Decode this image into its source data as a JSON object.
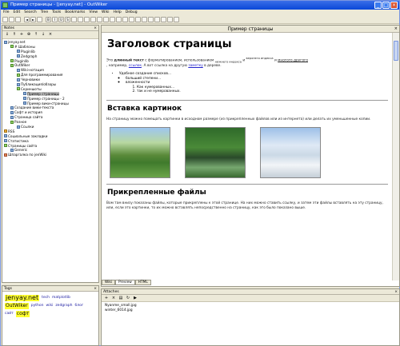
{
  "window": {
    "title": "Пример страницы - [jenyay.net] - OutWiker"
  },
  "menu": [
    "File",
    "Edit",
    "Search",
    "Tree",
    "Tools",
    "Bookmarks",
    "View",
    "Wiki",
    "Help",
    "Debug"
  ],
  "notes": {
    "title": "Notes",
    "close": "×",
    "tree": [
      {
        "d": 0,
        "label": "jenyay.net",
        "icon": "root"
      },
      {
        "d": 1,
        "label": "# Шаблоны",
        "icon": "fold"
      },
      {
        "d": 2,
        "label": "Pluginlib",
        "icon": "note"
      },
      {
        "d": 2,
        "label": "Zedgraph",
        "icon": "note"
      },
      {
        "d": 1,
        "label": "Pluginlib",
        "icon": "fold"
      },
      {
        "d": 1,
        "label": "OutWiker",
        "icon": "fold"
      },
      {
        "d": 2,
        "label": "Wiki-нотация",
        "icon": "note"
      },
      {
        "d": 2,
        "label": "Для программирования",
        "icon": "fold"
      },
      {
        "d": 2,
        "label": "Черновики",
        "icon": "note"
      },
      {
        "d": 2,
        "label": "Публикация/обзоры",
        "icon": "note"
      },
      {
        "d": 2,
        "label": "Скриншоты",
        "icon": "fold"
      },
      {
        "d": 3,
        "label": "Пример страницы",
        "icon": "note",
        "sel": true
      },
      {
        "d": 3,
        "label": "Пример страницы - 2",
        "icon": "note"
      },
      {
        "d": 3,
        "label": "Пример вики-страницы",
        "icon": "note"
      },
      {
        "d": 1,
        "label": "Создание вики-текста",
        "icon": "note"
      },
      {
        "d": 1,
        "label": "Софт и история",
        "icon": "note"
      },
      {
        "d": 1,
        "label": "Страница сайта",
        "icon": "note"
      },
      {
        "d": 1,
        "label": "Разное",
        "icon": "fold"
      },
      {
        "d": 2,
        "label": "Ссылки",
        "icon": "note"
      },
      {
        "d": 0,
        "label": "RSS",
        "icon": "orange"
      },
      {
        "d": 0,
        "label": "Социальные закладки",
        "icon": "note"
      },
      {
        "d": 0,
        "label": "Статистика",
        "icon": "note"
      },
      {
        "d": 0,
        "label": "Страницы сайта",
        "icon": "fold"
      },
      {
        "d": 1,
        "label": "Generic",
        "icon": "note"
      },
      {
        "d": 0,
        "label": "Шпаргалка по jenWiki",
        "icon": "red"
      }
    ]
  },
  "tags": {
    "title": "Tags",
    "close": "×",
    "items": [
      {
        "label": "jenyay.net",
        "size": "big"
      },
      {
        "label": "tech",
        "size": "small"
      },
      {
        "label": "matplotlib",
        "size": "small"
      },
      {
        "label": "OutWiker",
        "size": "med"
      },
      {
        "label": "python",
        "size": "small"
      },
      {
        "label": "wiki",
        "size": "small"
      },
      {
        "label": "zedgraph",
        "size": "small"
      },
      {
        "label": "блог",
        "size": "small"
      },
      {
        "label": "сайт",
        "size": "small"
      },
      {
        "label": "софт",
        "size": "med"
      }
    ]
  },
  "page": {
    "title": "Пример страницы",
    "close": "×",
    "h1": "Заголовок страницы",
    "p1a": "Это ",
    "p1b": "длинный текст",
    "p1c": " с форматированием, использованием ",
    "p1d": "нижнего индекса",
    "p1e": " и ",
    "p1f": "верхнего индекса",
    "p1g": " и ",
    "p1h": "многого другого",
    "p1_tail": ", например, ",
    "link1": "ссылок",
    "p1_mid": ". А вот ссылка на другую ",
    "link2": "заметку",
    "p1_end": " в дереве.",
    "list_top": "Удобное создание списков...",
    "list_2": "больший степени...",
    "list_3": "вложенности",
    "ol1": "Как нумерованных...",
    "ol2": "так и не нумерованных.",
    "h2a": "Вставка картинок",
    "p2": "На страницу можно помещать картинки в исходном размере (из прикрепленных файлов или из интернета) или делать их уменьшенные копии.",
    "h2b": "Прикрепленные файлы",
    "p3": "Вом там внизу показаны файлы, которые прикреплены к этой странице. На них можно ставить ссылку, и затем эти файлы вставлять на эту страницу, или, если это картинки, то их можно вставлять непосредственно на страницу, как это было показано выше.",
    "tabs": [
      "Wiki",
      "Preview",
      "HTML"
    ]
  },
  "attaches": {
    "title": "Attaches",
    "close": "×",
    "files": [
      "Nyanme_small.jpg",
      "winter_6014.jpg"
    ]
  }
}
